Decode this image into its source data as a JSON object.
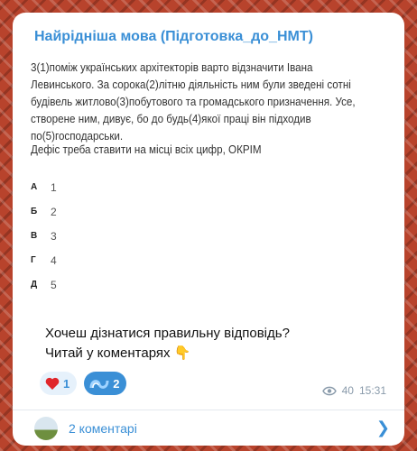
{
  "channel": {
    "name": "Найрідніша мова (Підготовка_до_НМТ)"
  },
  "post": {
    "text": "3(1)поміж українських архітекторів варто відзначити Івана Левинського. За сорока(2)літню діяльність ним були зведені сотні будівель житлово(3)побутового та громадського призначення. Усе, створене ним, дивує, бо до будь(4)якої праці він підходив по(5)господарськи.",
    "question": "Дефіс треба ставити на місці всіх цифр, ОКРІМ",
    "options": [
      {
        "letter": "А",
        "value": "1"
      },
      {
        "letter": "Б",
        "value": "2"
      },
      {
        "letter": "В",
        "value": "3"
      },
      {
        "letter": "Г",
        "value": "4"
      },
      {
        "letter": "Д",
        "value": "5"
      }
    ],
    "cta_line1": "Хочеш дізнатися правильну відповідь?",
    "cta_line2": "Читай у коментарях",
    "cta_emoji": "👇"
  },
  "reactions": [
    {
      "icon": "heart-icon",
      "count": "1"
    },
    {
      "icon": "rainbow-icon",
      "count": "2"
    }
  ],
  "meta": {
    "views": "40",
    "time": "15:31"
  },
  "comments": {
    "label": "2 коментарі"
  },
  "colors": {
    "accent": "#3a8fd6",
    "heart": "#e0262b"
  }
}
